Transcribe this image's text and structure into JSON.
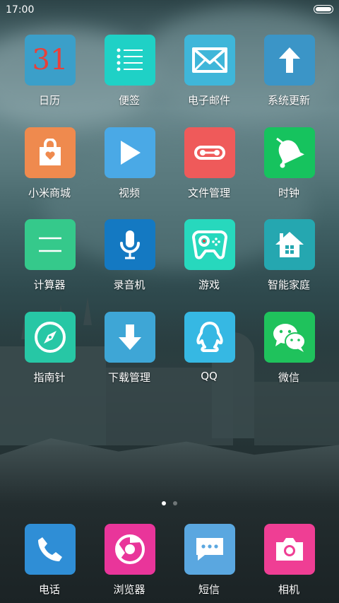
{
  "status": {
    "time": "17:00"
  },
  "apps": [
    {
      "label": "日历",
      "color": "#3b9fc9",
      "icon": "calendar-icon",
      "text": "31"
    },
    {
      "label": "便签",
      "color": "#1fd1c6",
      "icon": "notes-icon"
    },
    {
      "label": "电子邮件",
      "color": "#3fb6d9",
      "icon": "mail-icon"
    },
    {
      "label": "系统更新",
      "color": "#3b95c7",
      "icon": "update-arrow-icon"
    },
    {
      "label": "小米商城",
      "color": "#ef8a4e",
      "icon": "shopping-bag-icon"
    },
    {
      "label": "视频",
      "color": "#4aa9e6",
      "icon": "play-icon"
    },
    {
      "label": "文件管理",
      "color": "#ef5a5a",
      "icon": "file-manager-icon"
    },
    {
      "label": "时钟",
      "color": "#16c35e",
      "icon": "clock-bell-icon"
    },
    {
      "label": "计算器",
      "color": "#35c98b",
      "icon": "calculator-icon"
    },
    {
      "label": "录音机",
      "color": "#1479c2",
      "icon": "microphone-icon"
    },
    {
      "label": "游戏",
      "color": "#27d8bd",
      "icon": "gamepad-icon"
    },
    {
      "label": "智能家庭",
      "color": "#25a7b0",
      "icon": "smart-home-icon"
    },
    {
      "label": "指南针",
      "color": "#27c7a5",
      "icon": "compass-icon"
    },
    {
      "label": "下载管理",
      "color": "#3ea6d6",
      "icon": "download-icon"
    },
    {
      "label": "QQ",
      "color": "#36b8e3",
      "icon": "qq-penguin-icon"
    },
    {
      "label": "微信",
      "color": "#1fc25c",
      "icon": "wechat-icon"
    }
  ],
  "dock": [
    {
      "label": "电话",
      "color": "#2f8ed6",
      "icon": "phone-icon"
    },
    {
      "label": "浏览器",
      "color": "#e9359a",
      "icon": "browser-icon"
    },
    {
      "label": "短信",
      "color": "#5aa7e0",
      "icon": "message-icon"
    },
    {
      "label": "相机",
      "color": "#ef3e94",
      "icon": "camera-icon"
    }
  ],
  "page_indicator": {
    "count": 2,
    "active": 0
  }
}
